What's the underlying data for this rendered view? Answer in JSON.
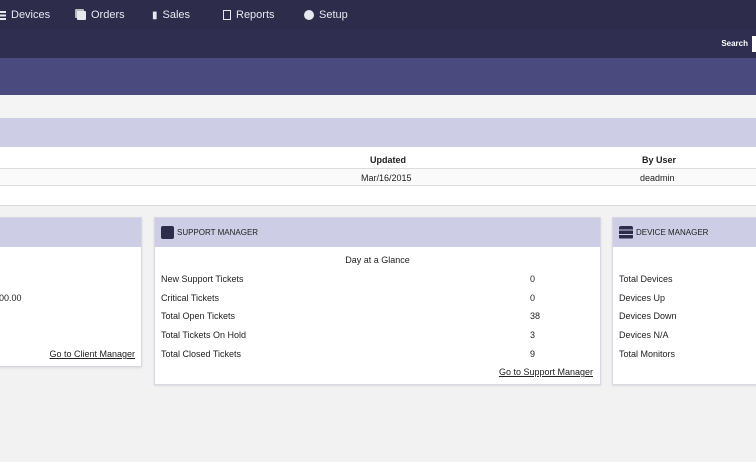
{
  "nav": {
    "items": [
      {
        "label": "Devices",
        "icon": "list-icon"
      },
      {
        "label": "Orders",
        "icon": "copy-icon"
      },
      {
        "label": "Sales",
        "icon": "bar-chart-icon"
      },
      {
        "label": "Reports",
        "icon": "clipboard-icon"
      },
      {
        "label": "Setup",
        "icon": "cloud-icon"
      }
    ]
  },
  "search": {
    "label": "Search"
  },
  "table": {
    "headers": [
      "Updated",
      "By User"
    ],
    "row": [
      "Mar/16/2015",
      "deadmin"
    ]
  },
  "client_panel": {
    "value": "00.00",
    "link": "Go to Client Manager"
  },
  "support_panel": {
    "title": "SUPPORT MANAGER",
    "subtitle": "Day at a Glance",
    "rows": [
      {
        "label": "New Support Tickets",
        "value": "0"
      },
      {
        "label": "Critical Tickets",
        "value": "0"
      },
      {
        "label": "Total Open Tickets",
        "value": "38"
      },
      {
        "label": "Total Tickets On Hold",
        "value": "3"
      },
      {
        "label": "Total Closed Tickets",
        "value": "9"
      }
    ],
    "link": "Go to Support Manager"
  },
  "device_panel": {
    "title": "DEVICE MANAGER",
    "rows": [
      "Total Devices",
      "Devices Up",
      "Devices Down",
      "Devices N/A",
      "Total Monitors"
    ]
  }
}
